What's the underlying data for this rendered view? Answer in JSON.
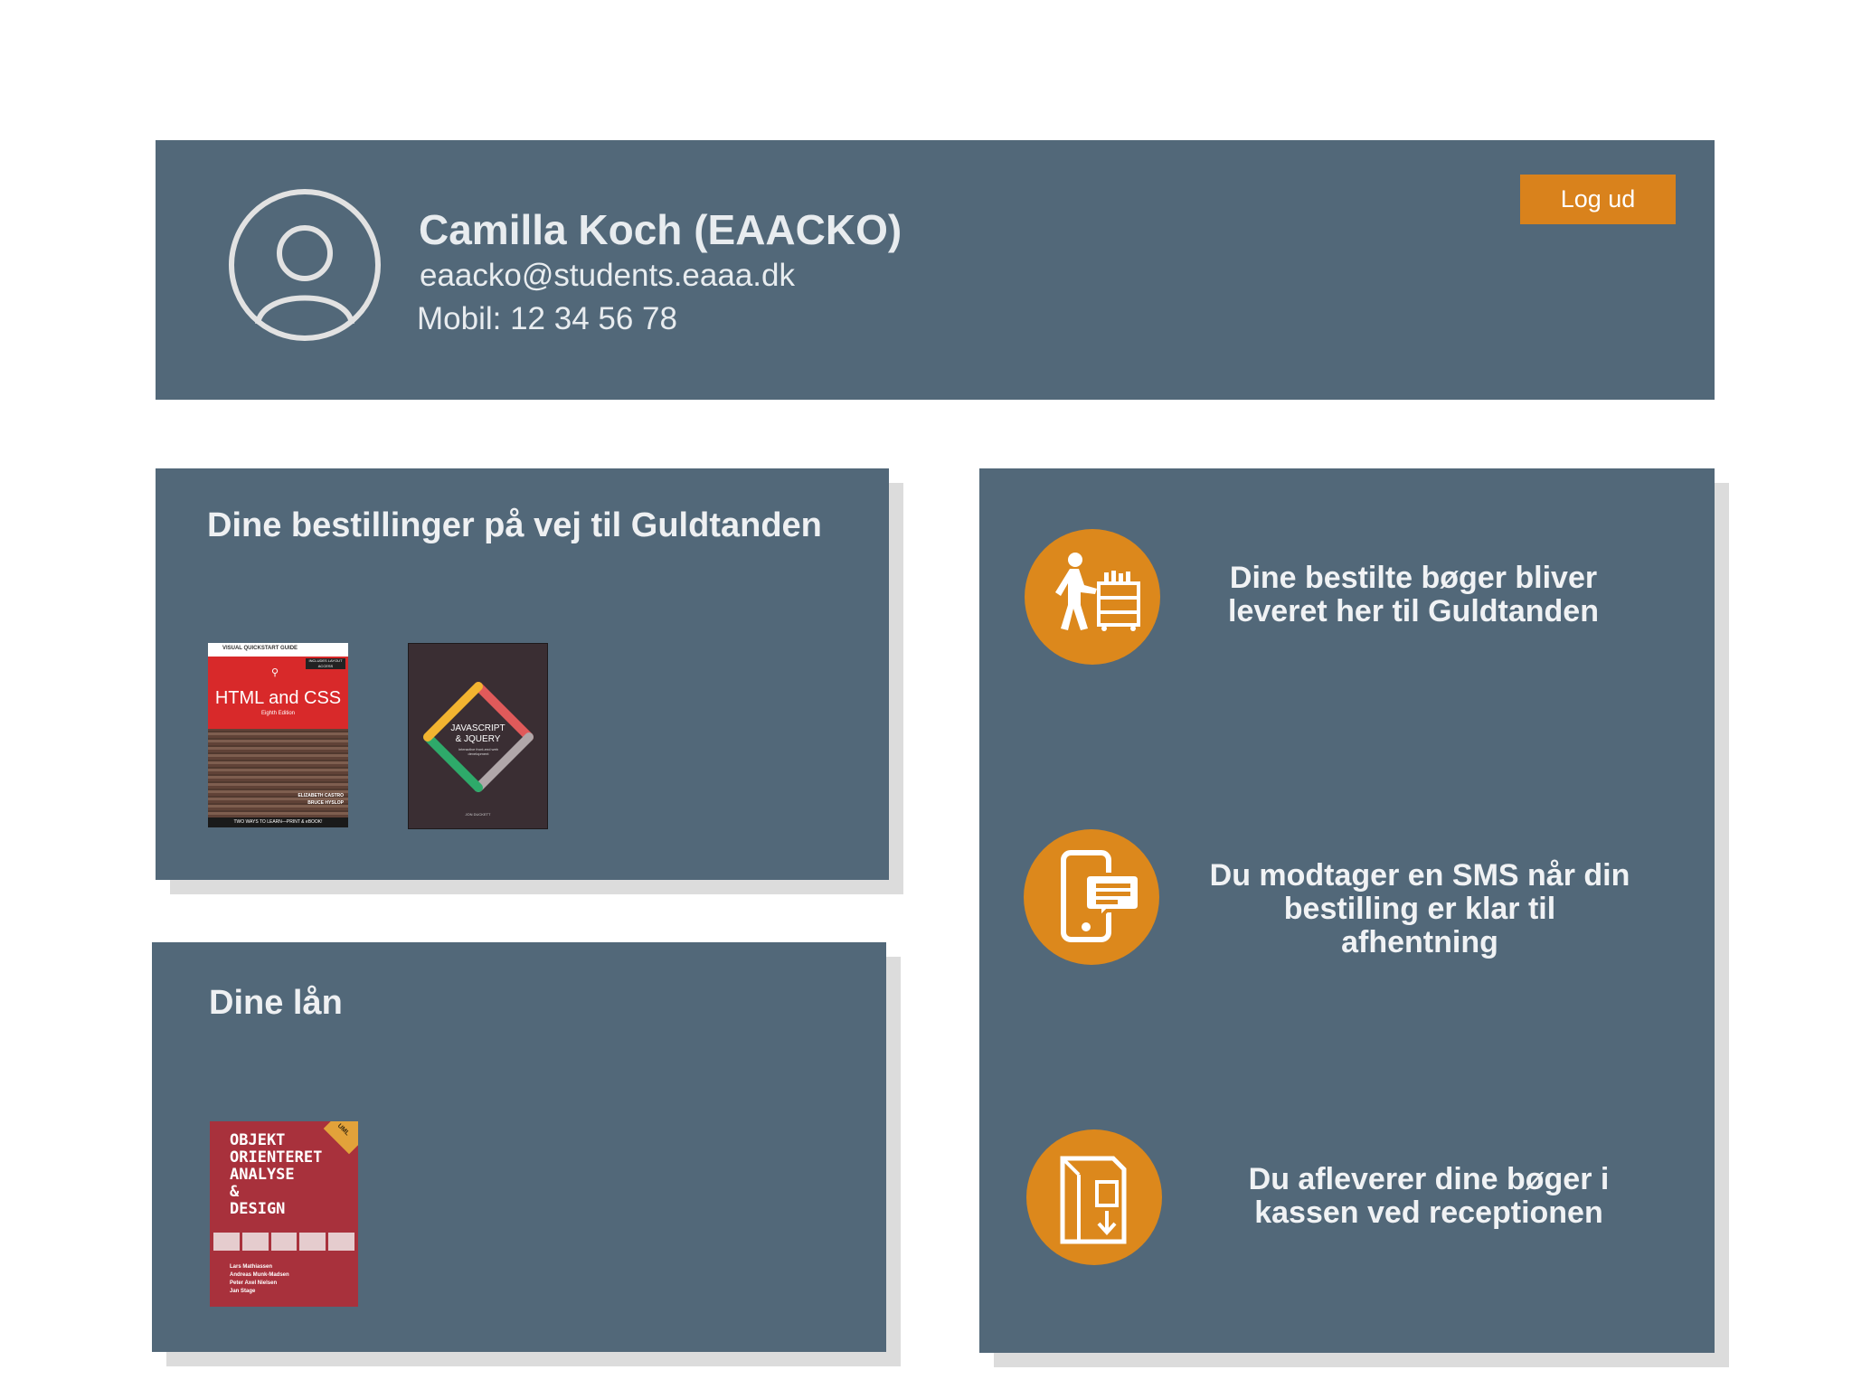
{
  "profile": {
    "name": "Camilla Koch (EAACKO)",
    "email": "eaacko@students.eaaa.dk",
    "mobile": "Mobil: 12 34 56 78",
    "logout_label": "Log ud"
  },
  "orders": {
    "title": "Dine bestillinger på vej til Guldtanden",
    "books": [
      {
        "series": "VISUAL QUICKSTART GUIDE",
        "badge": "INCLUDES LAYOUT ACCESS",
        "title": "HTML and CSS",
        "edition": "Eighth Edition",
        "authors": [
          "ELIZABETH CASTRO",
          "BRUCE HYSLOP"
        ],
        "footer": "TWO WAYS TO LEARN—PRINT & eBOOK!"
      },
      {
        "title_line1": "JAVASCRIPT",
        "title_line2": "& JQUERY",
        "subtitle": "interactive front-end web development",
        "author": "JON DUCKETT"
      }
    ]
  },
  "loans": {
    "title": "Dine lån",
    "books": [
      {
        "title_lines": [
          "OBJEKT",
          "ORIENTERET",
          "ANALYSE",
          "&",
          "DESIGN"
        ],
        "badge": "UML",
        "authors": [
          "Lars Mathiassen",
          "Andreas Munk-Madsen",
          "Peter Axel Nielsen",
          "Jan Stage"
        ]
      }
    ]
  },
  "steps": [
    {
      "icon": "book-cart-icon",
      "text": "Dine bestilte bøger bliver leveret her til Guldtanden"
    },
    {
      "icon": "phone-sms-icon",
      "text": "Du modtager en SMS når din bestilling er klar til afhentning"
    },
    {
      "icon": "return-box-icon",
      "text": "Du afleverer dine bøger i kassen ved receptionen"
    }
  ],
  "colors": {
    "panel": "#526879",
    "accent": "#dc881c",
    "text": "#eef0f2"
  }
}
